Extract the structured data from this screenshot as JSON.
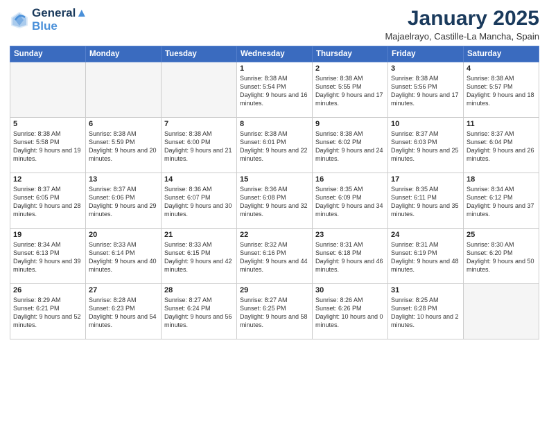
{
  "header": {
    "logo_line1": "General",
    "logo_line2": "Blue",
    "month_title": "January 2025",
    "subtitle": "Majaelrayo, Castille-La Mancha, Spain"
  },
  "weekdays": [
    "Sunday",
    "Monday",
    "Tuesday",
    "Wednesday",
    "Thursday",
    "Friday",
    "Saturday"
  ],
  "weeks": [
    [
      {
        "day": "",
        "info": ""
      },
      {
        "day": "",
        "info": ""
      },
      {
        "day": "",
        "info": ""
      },
      {
        "day": "1",
        "info": "Sunrise: 8:38 AM\nSunset: 5:54 PM\nDaylight: 9 hours\nand 16 minutes."
      },
      {
        "day": "2",
        "info": "Sunrise: 8:38 AM\nSunset: 5:55 PM\nDaylight: 9 hours\nand 17 minutes."
      },
      {
        "day": "3",
        "info": "Sunrise: 8:38 AM\nSunset: 5:56 PM\nDaylight: 9 hours\nand 17 minutes."
      },
      {
        "day": "4",
        "info": "Sunrise: 8:38 AM\nSunset: 5:57 PM\nDaylight: 9 hours\nand 18 minutes."
      }
    ],
    [
      {
        "day": "5",
        "info": "Sunrise: 8:38 AM\nSunset: 5:58 PM\nDaylight: 9 hours\nand 19 minutes."
      },
      {
        "day": "6",
        "info": "Sunrise: 8:38 AM\nSunset: 5:59 PM\nDaylight: 9 hours\nand 20 minutes."
      },
      {
        "day": "7",
        "info": "Sunrise: 8:38 AM\nSunset: 6:00 PM\nDaylight: 9 hours\nand 21 minutes."
      },
      {
        "day": "8",
        "info": "Sunrise: 8:38 AM\nSunset: 6:01 PM\nDaylight: 9 hours\nand 22 minutes."
      },
      {
        "day": "9",
        "info": "Sunrise: 8:38 AM\nSunset: 6:02 PM\nDaylight: 9 hours\nand 24 minutes."
      },
      {
        "day": "10",
        "info": "Sunrise: 8:37 AM\nSunset: 6:03 PM\nDaylight: 9 hours\nand 25 minutes."
      },
      {
        "day": "11",
        "info": "Sunrise: 8:37 AM\nSunset: 6:04 PM\nDaylight: 9 hours\nand 26 minutes."
      }
    ],
    [
      {
        "day": "12",
        "info": "Sunrise: 8:37 AM\nSunset: 6:05 PM\nDaylight: 9 hours\nand 28 minutes."
      },
      {
        "day": "13",
        "info": "Sunrise: 8:37 AM\nSunset: 6:06 PM\nDaylight: 9 hours\nand 29 minutes."
      },
      {
        "day": "14",
        "info": "Sunrise: 8:36 AM\nSunset: 6:07 PM\nDaylight: 9 hours\nand 30 minutes."
      },
      {
        "day": "15",
        "info": "Sunrise: 8:36 AM\nSunset: 6:08 PM\nDaylight: 9 hours\nand 32 minutes."
      },
      {
        "day": "16",
        "info": "Sunrise: 8:35 AM\nSunset: 6:09 PM\nDaylight: 9 hours\nand 34 minutes."
      },
      {
        "day": "17",
        "info": "Sunrise: 8:35 AM\nSunset: 6:11 PM\nDaylight: 9 hours\nand 35 minutes."
      },
      {
        "day": "18",
        "info": "Sunrise: 8:34 AM\nSunset: 6:12 PM\nDaylight: 9 hours\nand 37 minutes."
      }
    ],
    [
      {
        "day": "19",
        "info": "Sunrise: 8:34 AM\nSunset: 6:13 PM\nDaylight: 9 hours\nand 39 minutes."
      },
      {
        "day": "20",
        "info": "Sunrise: 8:33 AM\nSunset: 6:14 PM\nDaylight: 9 hours\nand 40 minutes."
      },
      {
        "day": "21",
        "info": "Sunrise: 8:33 AM\nSunset: 6:15 PM\nDaylight: 9 hours\nand 42 minutes."
      },
      {
        "day": "22",
        "info": "Sunrise: 8:32 AM\nSunset: 6:16 PM\nDaylight: 9 hours\nand 44 minutes."
      },
      {
        "day": "23",
        "info": "Sunrise: 8:31 AM\nSunset: 6:18 PM\nDaylight: 9 hours\nand 46 minutes."
      },
      {
        "day": "24",
        "info": "Sunrise: 8:31 AM\nSunset: 6:19 PM\nDaylight: 9 hours\nand 48 minutes."
      },
      {
        "day": "25",
        "info": "Sunrise: 8:30 AM\nSunset: 6:20 PM\nDaylight: 9 hours\nand 50 minutes."
      }
    ],
    [
      {
        "day": "26",
        "info": "Sunrise: 8:29 AM\nSunset: 6:21 PM\nDaylight: 9 hours\nand 52 minutes."
      },
      {
        "day": "27",
        "info": "Sunrise: 8:28 AM\nSunset: 6:23 PM\nDaylight: 9 hours\nand 54 minutes."
      },
      {
        "day": "28",
        "info": "Sunrise: 8:27 AM\nSunset: 6:24 PM\nDaylight: 9 hours\nand 56 minutes."
      },
      {
        "day": "29",
        "info": "Sunrise: 8:27 AM\nSunset: 6:25 PM\nDaylight: 9 hours\nand 58 minutes."
      },
      {
        "day": "30",
        "info": "Sunrise: 8:26 AM\nSunset: 6:26 PM\nDaylight: 10 hours\nand 0 minutes."
      },
      {
        "day": "31",
        "info": "Sunrise: 8:25 AM\nSunset: 6:28 PM\nDaylight: 10 hours\nand 2 minutes."
      },
      {
        "day": "",
        "info": ""
      }
    ]
  ]
}
